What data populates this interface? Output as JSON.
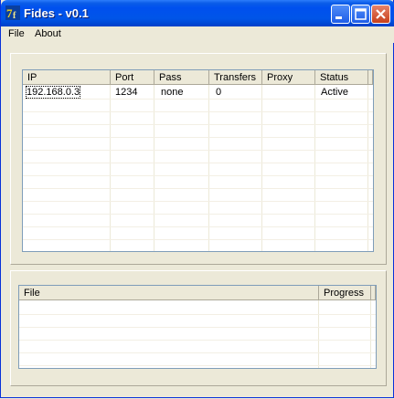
{
  "window": {
    "title": "Fides - v0.1"
  },
  "menu": {
    "file": "File",
    "about": "About"
  },
  "servers": {
    "columns": [
      "IP",
      "Port",
      "Pass",
      "Transfers",
      "Proxy",
      "Status"
    ],
    "rows": [
      {
        "ip": "192.168.0.3",
        "port": "1234",
        "pass": "none",
        "transfers": "0",
        "proxy": "",
        "status": "Active"
      }
    ]
  },
  "files": {
    "columns": [
      "File",
      "Progress"
    ],
    "rows": []
  },
  "colors": {
    "titlebar": "#0055e8",
    "face": "#ece9d8",
    "close": "#c8401b"
  }
}
